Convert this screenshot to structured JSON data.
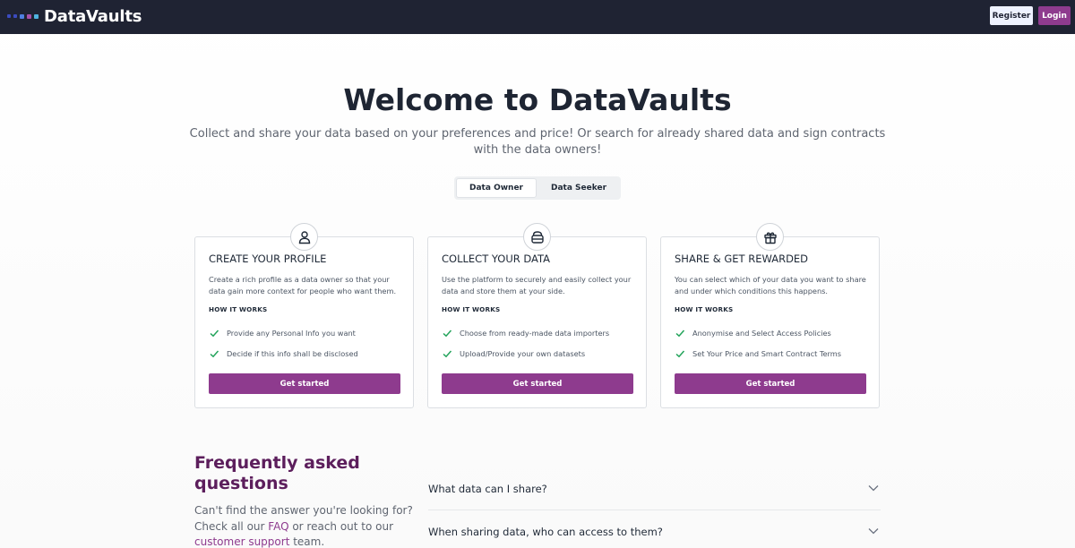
{
  "header": {
    "brand": "DataVaults",
    "register_label": "Register",
    "login_label": "Login",
    "logo_dot_colors": [
      "#3b4bbf",
      "#3b4bbf",
      "#4f7fe0",
      "#a84fa8",
      "#4fb3e0"
    ]
  },
  "hero": {
    "title": "Welcome to DataVaults",
    "subtitle": "Collect and share your data based on your preferences and price! Or search for already shared data and sign contracts with the data owners!"
  },
  "toggle": {
    "options": [
      "Data Owner",
      "Data Seeker"
    ],
    "selected": "Data Owner"
  },
  "cards": [
    {
      "icon": "user-icon",
      "title": "CREATE YOUR PROFILE",
      "description": "Create a rich profile as a data owner so that your data gain more context for people who want them.",
      "how_label": "HOW IT WORKS",
      "features": [
        "Provide any Personal Info you want",
        "Decide if this info shall be disclosed"
      ],
      "cta": "Get started"
    },
    {
      "icon": "database-icon",
      "title": "COLLECT YOUR DATA",
      "description": "Use the platform to securely and easily collect your data and store them at your side.",
      "how_label": "HOW IT WORKS",
      "features": [
        "Choose from ready-made data importers",
        "Upload/Provide your own datasets"
      ],
      "cta": "Get started"
    },
    {
      "icon": "gift-icon",
      "title": "SHARE & GET REWARDED",
      "description": "You can select which of your data you want to share and under which conditions this happens.",
      "how_label": "HOW IT WORKS",
      "features": [
        "Anonymise and Select Access Policies",
        "Set Your Price and Smart Contract Terms"
      ],
      "cta": "Get started"
    }
  ],
  "faq": {
    "title": "Frequently asked questions",
    "desc_before": "Can't find the answer you're looking for? Check all our ",
    "faq_link": "FAQ",
    "desc_middle": " or reach out to our ",
    "support_link": "customer support",
    "desc_after": " team.",
    "questions": [
      "What data can I share?",
      "When sharing data, who can access to them?"
    ]
  },
  "colors": {
    "nav_bg": "#1f2333",
    "accent": "#8e3b8e",
    "faq_heading": "#5c1e5c",
    "check": "#22a35a"
  }
}
